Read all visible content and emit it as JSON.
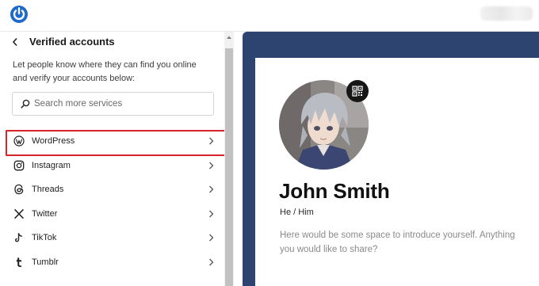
{
  "panel": {
    "title": "Verified accounts",
    "description": "Let people know where they can find you online and verify your accounts below:",
    "search_placeholder": "Search more services"
  },
  "services": [
    {
      "label": "WordPress",
      "icon": "wordpress-icon",
      "highlighted": true
    },
    {
      "label": "Instagram",
      "icon": "instagram-icon"
    },
    {
      "label": "Threads",
      "icon": "threads-icon"
    },
    {
      "label": "Twitter",
      "icon": "twitter-x-icon"
    },
    {
      "label": "TikTok",
      "icon": "tiktok-icon"
    },
    {
      "label": "Tumblr",
      "icon": "tumblr-icon"
    }
  ],
  "profile": {
    "name": "John Smith",
    "pronouns": "He / Him",
    "bio": "Here would be some space to introduce yourself. Anything you would like to share?"
  },
  "colors": {
    "brand": "#1c6ac9",
    "preview_background": "#2e4470",
    "highlight_border": "#d9232a"
  }
}
